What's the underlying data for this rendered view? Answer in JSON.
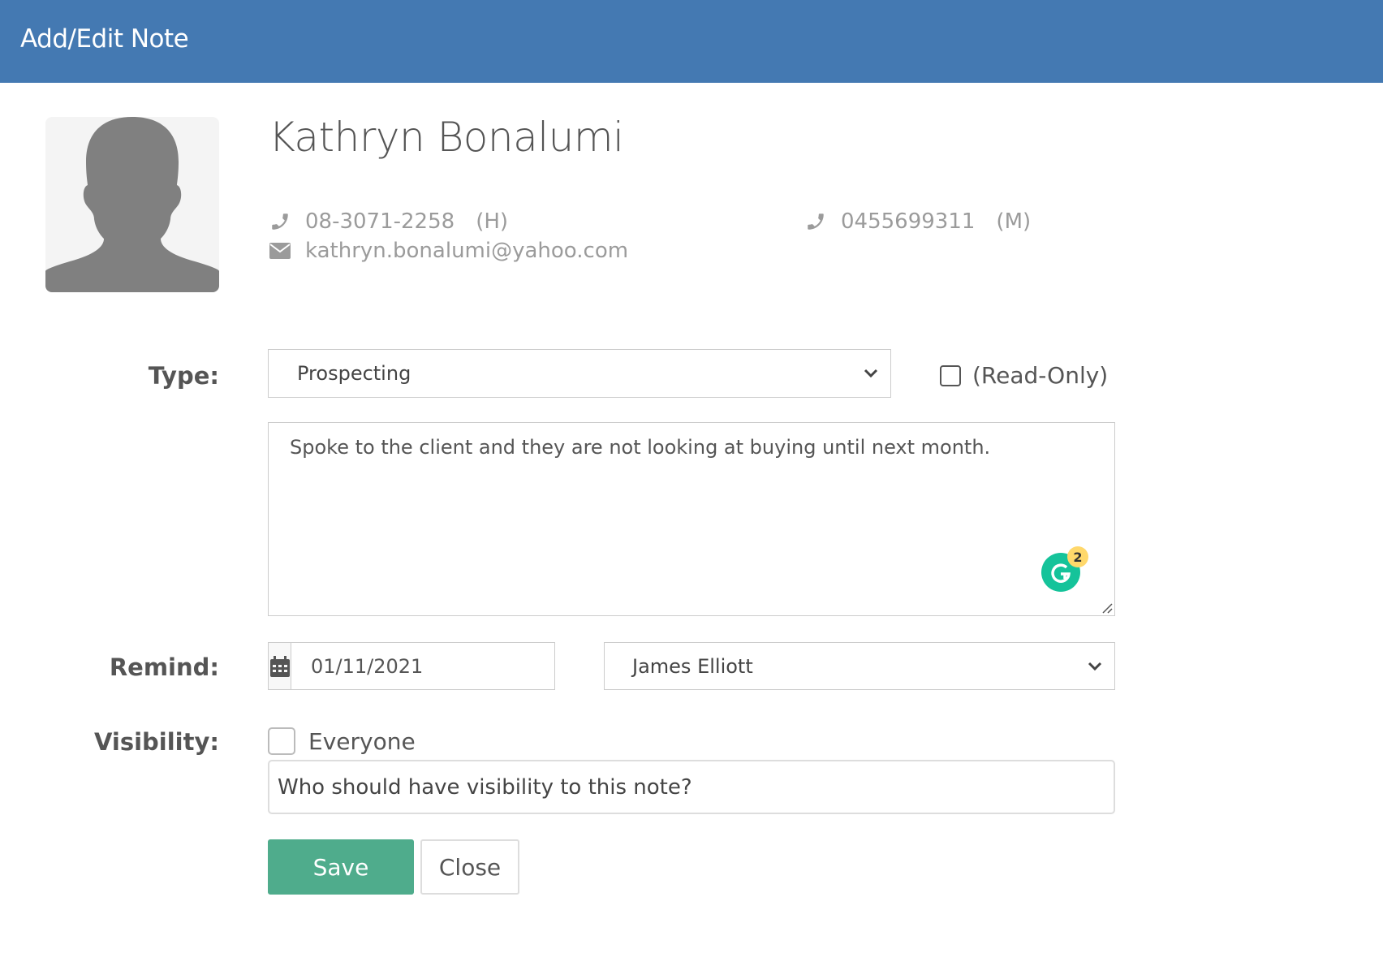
{
  "header": {
    "title": "Add/Edit Note"
  },
  "contact": {
    "name": "Kathryn Bonalumi",
    "home_phone": "08-3071-2258",
    "home_tag": "(H)",
    "mobile_phone": "0455699311",
    "mobile_tag": "(M)",
    "email": "kathryn.bonalumi@yahoo.com"
  },
  "form": {
    "type_label": "Type:",
    "type_value": "Prospecting",
    "read_only_label": "(Read-Only)",
    "note_text": "Spoke to the client and they are not looking at buying until next month.",
    "grammarly_count": "2",
    "remind_label": "Remind:",
    "remind_date": "01/11/2021",
    "remind_user": "James Elliott",
    "visibility_label": "Visibility:",
    "everyone_label": "Everyone",
    "visibility_placeholder": "Who should have visibility to this note?"
  },
  "buttons": {
    "save": "Save",
    "close": "Close"
  },
  "colors": {
    "header": "#4479b2",
    "save": "#4fac8c",
    "grammarly": "#15c39a"
  },
  "icons": [
    "user-silhouette-icon",
    "phone-icon",
    "envelope-icon",
    "chevron-down-icon",
    "calendar-icon",
    "grammarly-icon"
  ]
}
